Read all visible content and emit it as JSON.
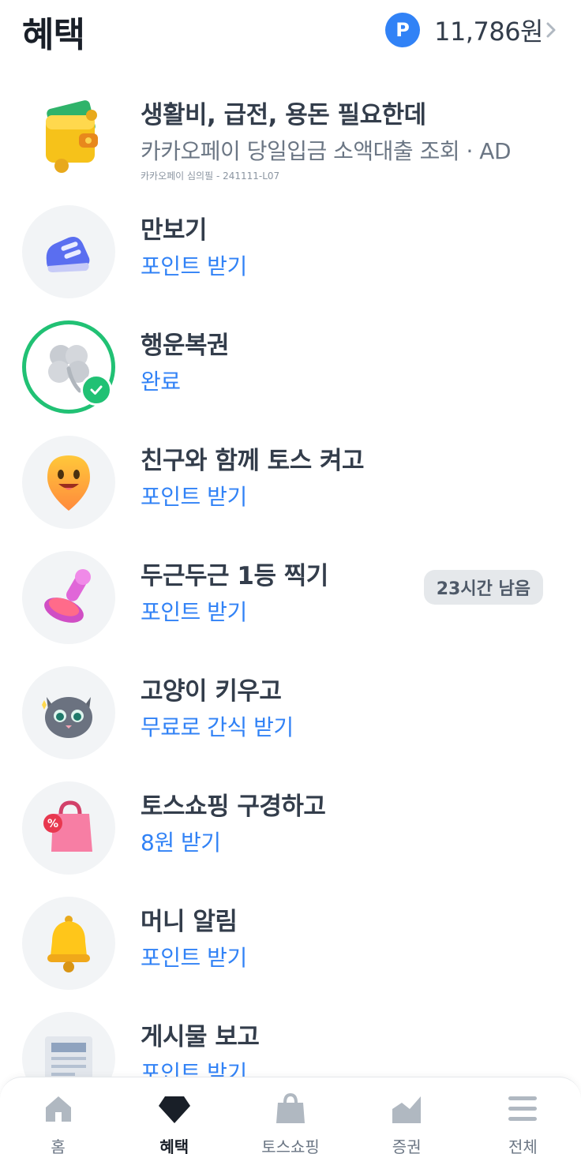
{
  "header": {
    "title": "혜택",
    "points_badge": "P",
    "points_value": "11,786원"
  },
  "items": [
    {
      "title": "생활비, 급전, 용돈 필요한데",
      "subtitle": "카카오페이 당일입금 소액대출 조회 · AD",
      "disclaimer": "카카오페이 심의필 - 241111-L07",
      "icon": "wallet-icon"
    },
    {
      "title": "만보기",
      "subtitle": "포인트 받기",
      "icon": "sneaker-icon"
    },
    {
      "title": "행운복권",
      "subtitle": "완료",
      "icon": "clover-icon",
      "completed": true
    },
    {
      "title": "친구와 함께 토스 켜고",
      "subtitle": "포인트 받기",
      "icon": "smiley-pin-icon"
    },
    {
      "title": "두근두근 1등 찍기",
      "subtitle": "포인트 받기",
      "icon": "stamp-icon",
      "badge": "23시간 남음"
    },
    {
      "title": "고양이 키우고",
      "subtitle": "무료로 간식 받기",
      "icon": "cat-icon"
    },
    {
      "title": "토스쇼핑 구경하고",
      "subtitle": "8원 받기",
      "icon": "shopping-bag-icon"
    },
    {
      "title": "머니 알림",
      "subtitle": "포인트 받기",
      "icon": "bell-icon"
    },
    {
      "title": "게시물 보고",
      "subtitle": "포인트 받기",
      "icon": "newspaper-icon"
    }
  ],
  "tabbar": {
    "tabs": [
      {
        "label": "홈",
        "icon": "home-icon"
      },
      {
        "label": "혜택",
        "icon": "gem-icon",
        "active": true
      },
      {
        "label": "토스쇼핑",
        "icon": "bag-icon"
      },
      {
        "label": "증권",
        "icon": "stock-chart-icon"
      },
      {
        "label": "전체",
        "icon": "menu-icon"
      }
    ]
  },
  "colors": {
    "accent": "#3182f6",
    "success": "#21c174",
    "text": "#333d4b"
  }
}
